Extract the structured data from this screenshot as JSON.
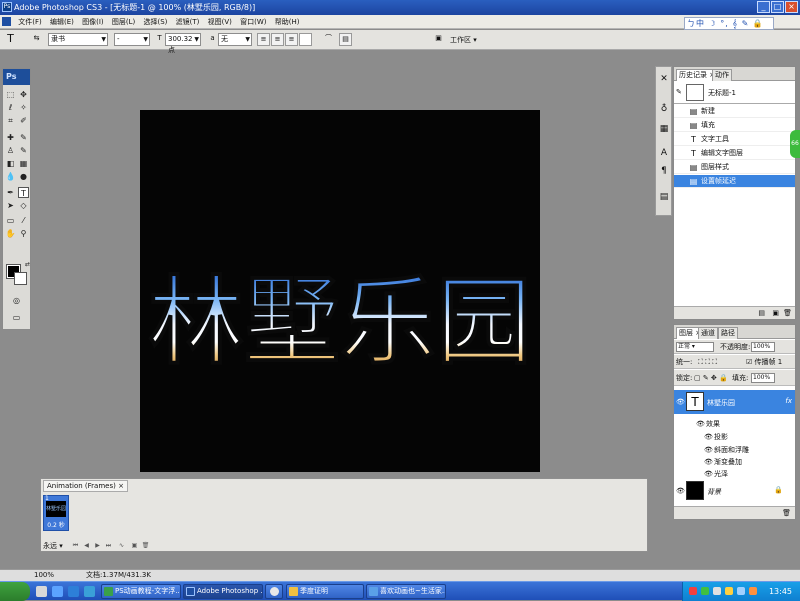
{
  "window": {
    "title": "Adobe Photoshop CS3 - [无标题-1 @ 100% (林墅乐园, RGB/8)]"
  },
  "menubar": {
    "items": [
      "文件(F)",
      "编辑(E)",
      "图像(I)",
      "图层(L)",
      "选择(S)",
      "滤镜(T)",
      "视图(V)",
      "窗口(W)",
      "帮助(H)"
    ]
  },
  "ime": {
    "text": "ㄅ中 ☽ °, 𝄞 ✎ 🔒 ✦"
  },
  "options": {
    "font_family": "隶书",
    "font_style": "-",
    "font_size": "300.32 点",
    "antialias": "无",
    "workspace": "工作区 ▾"
  },
  "canvas_text": "林墅乐园",
  "history": {
    "tabs": [
      "历史记录",
      "动作"
    ],
    "snapshot": "无标题-1",
    "items": [
      {
        "label": "新建",
        "icon": "doc-icon"
      },
      {
        "label": "填充",
        "icon": "doc-icon"
      },
      {
        "label": "文字工具",
        "icon": "type-icon"
      },
      {
        "label": "编辑文字图层",
        "icon": "type-icon"
      },
      {
        "label": "图层样式",
        "icon": "doc-icon"
      },
      {
        "label": "设置帧延迟",
        "icon": "doc-icon",
        "selected": true
      }
    ]
  },
  "layers": {
    "tabs": [
      "图层",
      "通道",
      "路径"
    ],
    "blend_mode": "正常",
    "opacity_label": "不透明度:",
    "opacity": "100%",
    "unify_label": "统一:",
    "propagate_label": "传播帧 1",
    "lock_label": "锁定:",
    "fill_label": "填充:",
    "fill": "100%",
    "text_layer_name": "林墅乐园",
    "fx_label": "fx",
    "effects_label": "效果",
    "effects": [
      "投影",
      "斜面和浮雕",
      "渐变叠加",
      "光泽"
    ],
    "bg_layer_name": "背景"
  },
  "animation": {
    "tab": "Animation (Frames)",
    "frame_number": "1",
    "frame_thumb_text": "林墅乐园",
    "frame_delay": "0.2 秒",
    "loop": "永远"
  },
  "status": {
    "zoom": "100%",
    "doc": "文档:1.37M/431.3K"
  },
  "taskbar": {
    "tasks": [
      {
        "label": "PS动画教程-文字浮...",
        "color": "#3aa04a"
      },
      {
        "label": "Adobe Photoshop ...",
        "color": "#1e4fa3",
        "active": true
      },
      {
        "label": "",
        "color": "#e8e8e8"
      },
      {
        "label": "季度证明",
        "color": "#f0c040"
      },
      {
        "label": "喜欢动画也~生活家...",
        "color": "#5aa0e8"
      }
    ],
    "clock": "13:45"
  },
  "colors": {
    "accent": "#3a84e0",
    "titlebar": "#2a5fbf",
    "canvas_bg": "#050505"
  }
}
